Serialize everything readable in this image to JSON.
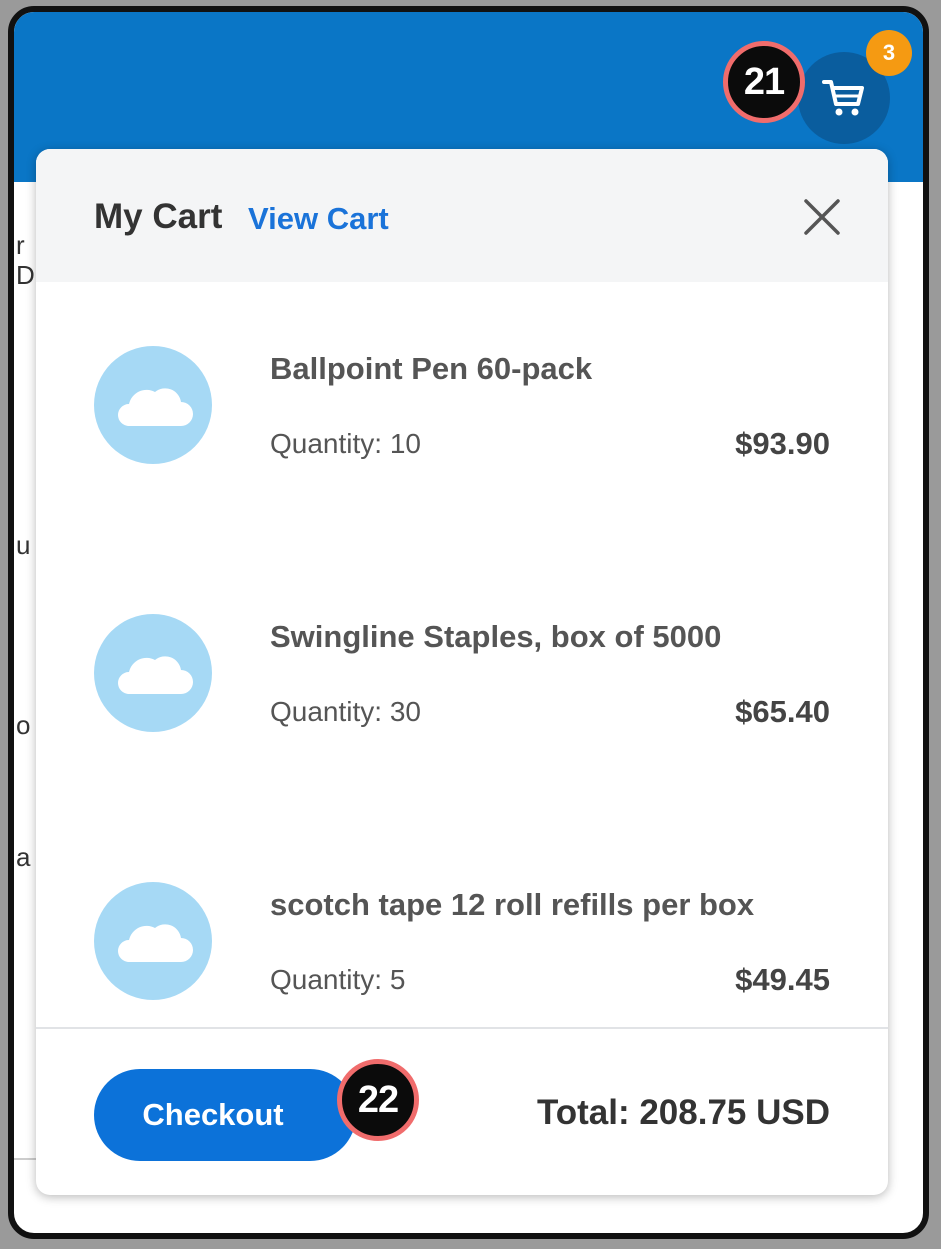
{
  "header": {
    "cart_badge_count": "3",
    "annotation_markers": [
      "21",
      "22"
    ]
  },
  "background_page": {
    "partial_letters": [
      "r",
      "D",
      "u",
      "o",
      "a"
    ]
  },
  "cart_panel": {
    "title": "My Cart",
    "view_cart_label": "View Cart",
    "items": [
      {
        "name": "Ballpoint Pen 60-pack",
        "quantity": "Quantity: 10",
        "price": "$93.90"
      },
      {
        "name": "Swingline Staples, box of 5000",
        "quantity": "Quantity: 30",
        "price": "$65.40"
      },
      {
        "name": "scotch tape 12 roll refills per box",
        "quantity": "Quantity: 5",
        "price": "$49.45"
      }
    ],
    "checkout_label": "Checkout",
    "total": "Total: 208.75 USD"
  },
  "icons": {
    "cart": "shopping-cart-icon",
    "close": "close-icon",
    "thumbnail": "cloud-icon"
  },
  "colors": {
    "topbar": "#0a76c6",
    "accent": "#1a73d9",
    "badge": "#f59a12",
    "thumbnail": "#a6d9f5"
  }
}
